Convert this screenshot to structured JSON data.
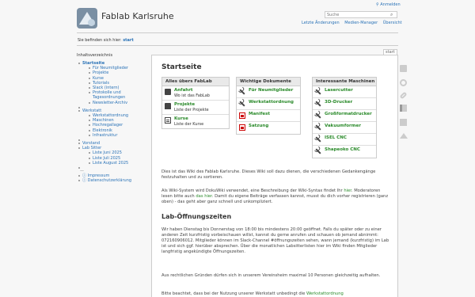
{
  "header": {
    "site_title": "Fablab Karlsruhe",
    "login": "Anmelden",
    "search_placeholder": "Suche",
    "links": [
      "Letzte Änderungen",
      "Medien-Manager",
      "Übersicht"
    ]
  },
  "breadcrumb": {
    "prefix": "Sie befinden sich hier:",
    "current": "start"
  },
  "toc": {
    "title": "Inhaltsverzeichnis",
    "start": "Startseite",
    "start_children": [
      "Für Neumitglieder",
      "Projekte",
      "Kurse",
      "Tutorials",
      "Slack (intern)",
      "Protokolle und",
      "Tagesordnungen",
      "Newsletter-Archiv"
    ],
    "werkstatt": "Werkstatt",
    "werkstatt_children": [
      "Werkstattordnung",
      "Maschinen",
      "Hochregallager",
      "Elektronik",
      "Infrastruktur"
    ],
    "vorstand": "Vorstand",
    "labsitter": "Lab Sitter",
    "labsitter_children": [
      "Liste Juni 2025",
      "Liste Juli 2025",
      "Liste August 2025"
    ],
    "sep": "—",
    "impressum": "Impressum",
    "datenschutz": "Datenschutzerklärung"
  },
  "page": {
    "tab_label": "start",
    "title": "Startseite",
    "box1": {
      "header": "Alles übers FabLab",
      "items": [
        {
          "icon": "map-icon",
          "link": "Anfahrt",
          "desc": "Wo ist das FabLab"
        },
        {
          "icon": "folder-icon",
          "link": "Projekte",
          "desc": "Liste der Projekte"
        },
        {
          "icon": "course-icon",
          "link": "Kurse",
          "desc": "Liste der Kurse"
        }
      ]
    },
    "box2": {
      "header": "Wichtige Dokumente",
      "items": [
        {
          "icon": "wrench-icon",
          "link": "Für Neumitglieder"
        },
        {
          "icon": "wrench-icon",
          "link": "Werkstattordnung"
        },
        {
          "icon": "pdf-icon",
          "link": "Manifest"
        },
        {
          "icon": "pdf-icon",
          "link": "Satzung"
        }
      ]
    },
    "box3": {
      "header": "Interessante Maschinen",
      "items": [
        {
          "icon": "wrench-icon",
          "link": "Lasercutter"
        },
        {
          "icon": "wrench-icon",
          "link": "3D-Drucker"
        },
        {
          "icon": "wrench-icon",
          "link": "Großformatdrucker"
        },
        {
          "icon": "wrench-icon",
          "link": "Vakuumformer"
        },
        {
          "icon": "wrench-icon",
          "link": "ISEL CNC"
        },
        {
          "icon": "wrench-icon",
          "link": "Shapeoko CNC"
        }
      ]
    },
    "intro": "Dies ist das Wiki des Fablab Karlsruhe. Dieses Wiki soll dazu dienen, die verschiedenen Gedankengänge festzuhalten und zu sortieren.",
    "wiki_text_a": "Als Wiki-System wird DokuWiki verwendet, eine Beschreibung der Wiki-Syntax findet Ihr",
    "wiki_link_hier": "hier",
    "wiki_text_b": ". Moderatoren lesen bitte auch",
    "wiki_link_das_hier": "das hier",
    "wiki_text_c": ". Damit du eigene Beiträge verfassen kannst, musst du dich vorher registrieren (ganz oben) - das geht aber ganz schnell und unkompliziert.",
    "h2": "Lab-Öffnungszeiten",
    "hours": "Wir haben Dienstag bis Donnerstag von 18:00 bis mindestens 20:00 geöffnet. Falls du später oder zu einer anderen Zeit kurzfristig vorbeischauen willst, kannst du gerne anrufen und schauen ob jemand abnimmt: 072160906012. Mitglieder können im Slack-Channel #öffnungszeiten sehen, wann jemand (kurzfristig) im Lab ist und sich ggf. hierüber absprechen. Über die monatlichen Labsitterlisten hier im Wiki finden Mitglieder langfristig angekündigte Öffnungszeiten.",
    "legal": "Aus rechtlichen Gründen dürfen sich in unserem Vereinsheim maximal 10 Personen gleichzeitig aufhalten.",
    "bottom_a": "Bitte beachtet, dass bei der Nutzung unserer Werkstatt unbedingt die",
    "bottom_link": "Werkstattordnung"
  },
  "page_tools": [
    "document-icon",
    "history-icon",
    "backlinks-icon",
    "back-icon",
    "sitemap-icon",
    "to-top-icon"
  ]
}
